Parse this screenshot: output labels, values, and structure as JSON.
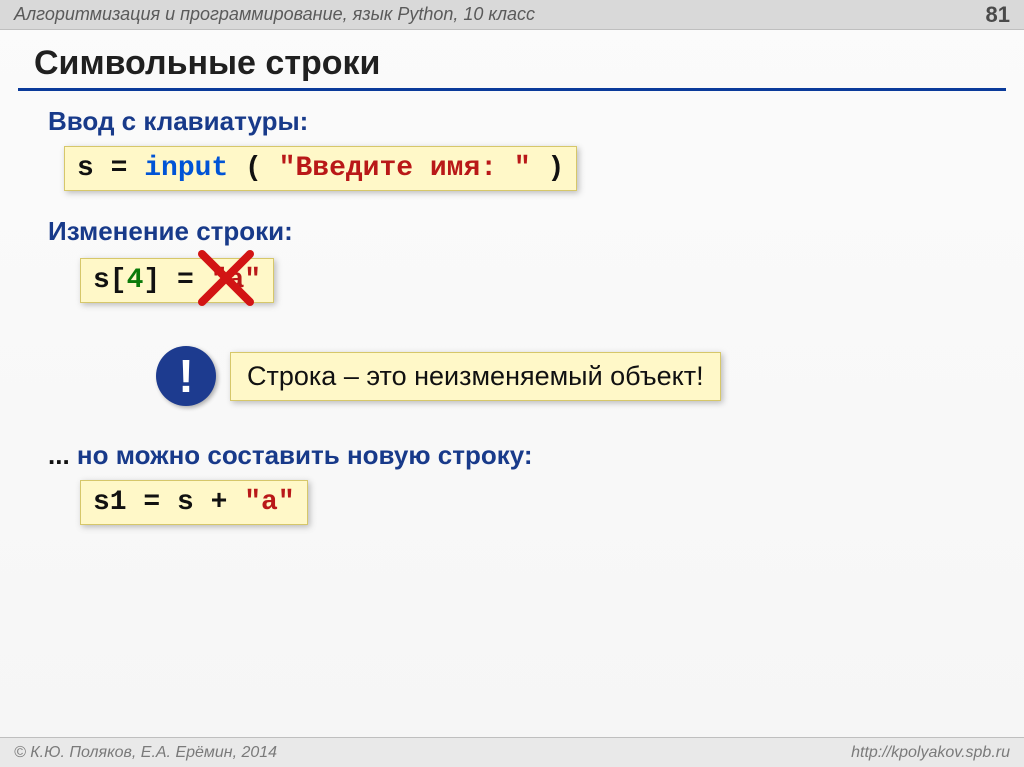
{
  "header": {
    "breadcrumb": "Алгоритмизация и программирование, язык Python, 10 класс",
    "page_number": "81"
  },
  "title": "Символьные строки",
  "section1": {
    "heading": "Ввод с клавиатуры:",
    "code": {
      "assign": "s = ",
      "func": "input",
      "open": " ( ",
      "str": "\"Введите имя: \"",
      "close": " )"
    }
  },
  "section2": {
    "heading": "Изменение строки:",
    "code": {
      "lhs1": "s[",
      "idx": "4",
      "lhs2": "] = ",
      "rhs": "\"a\""
    }
  },
  "callout": {
    "bang": "!",
    "text": "Строка – это неизменяемый объект!"
  },
  "section3": {
    "prefix": "... ",
    "heading": "но можно составить новую строку:",
    "code": {
      "lhs": "s1 = s + ",
      "rhs": "\"a\""
    }
  },
  "footer": {
    "copyright": "© К.Ю. Поляков, Е.А. Ерёмин, 2014",
    "url": "http://kpolyakov.spb.ru"
  }
}
